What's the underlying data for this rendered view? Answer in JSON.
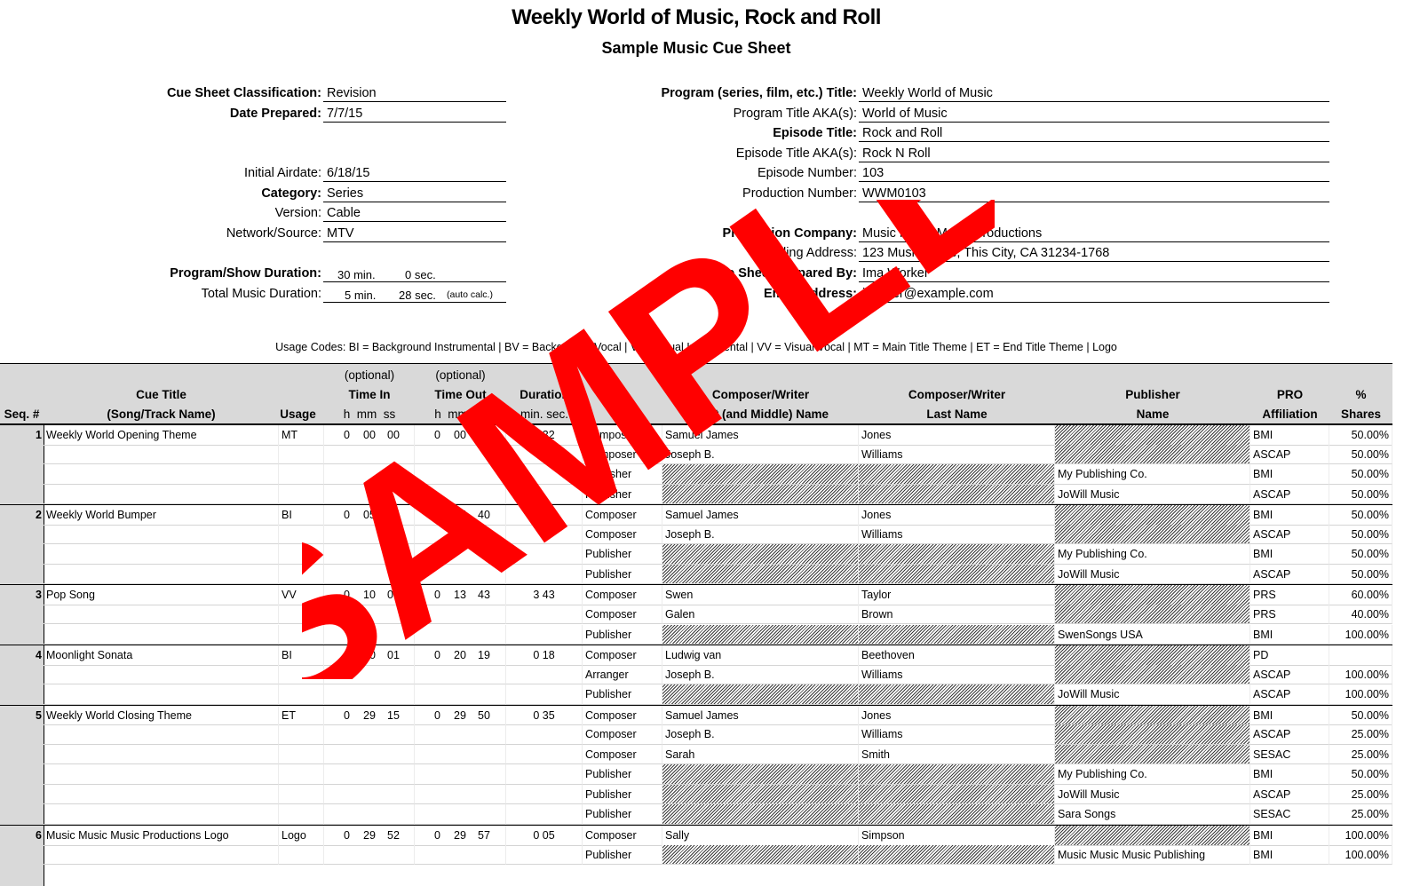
{
  "header": {
    "title": "Weekly World of Music, Rock and Roll",
    "subtitle": "Sample Music Cue Sheet"
  },
  "left_fields": [
    {
      "label": "Cue Sheet Classification:",
      "bold": true,
      "value": "Revision"
    },
    {
      "label": "Date Prepared:",
      "bold": true,
      "value": "7/7/15"
    },
    {
      "label": "Initial Airdate:",
      "bold": false,
      "value": "6/18/15"
    },
    {
      "label": "Category:",
      "bold": true,
      "value": "Series"
    },
    {
      "label": "Version:",
      "bold": false,
      "value": "Cable"
    },
    {
      "label": "Network/Source:",
      "bold": false,
      "value": "MTV"
    }
  ],
  "durations": {
    "program": {
      "label": "Program/Show Duration:",
      "min": "30 min.",
      "sec": "0 sec.",
      "note": ""
    },
    "music": {
      "label": "Total Music Duration:",
      "min": "5 min.",
      "sec": "28 sec.",
      "note": "(auto calc.)"
    }
  },
  "right_fields": [
    {
      "label": "Program (series, film, etc.) Title:",
      "bold": true,
      "value": "Weekly World of Music"
    },
    {
      "label": "Program Title AKA(s):",
      "bold": false,
      "value": "World of Music"
    },
    {
      "label": "Episode Title:",
      "bold": true,
      "value": "Rock and Roll"
    },
    {
      "label": "Episode Title AKA(s):",
      "bold": false,
      "value": "Rock N Roll"
    },
    {
      "label": "Episode Number:",
      "bold": false,
      "value": "103"
    },
    {
      "label": "Production Number:",
      "bold": false,
      "value": "WWM0103"
    },
    {
      "label": "Production Company:",
      "bold": true,
      "value": "Music Music Music Productions"
    },
    {
      "label": "Mailing Address:",
      "bold": false,
      "value": "123 Music Place, This City, CA 31234-1768"
    },
    {
      "label": "Cue Sheet Prepared By:",
      "bold": true,
      "value": "Ima Worker"
    },
    {
      "label": "Email Address:",
      "bold": true,
      "value": "iworker@example.com"
    }
  ],
  "usage_codes": "Usage Codes:  BI = Background Instrumental | BV = Background Vocal | VI = Visual Instrumental | VV = Visual Vocal | MT = Main Title Theme | ET = End Title Theme | Logo",
  "table": {
    "headers": {
      "seq": "Seq. #",
      "cue_title_1": "Cue Title",
      "cue_title_2": "(Song/Track Name)",
      "usage": "Usage",
      "optional": "(optional)",
      "time_in": "Time In",
      "time_out": "Time Out",
      "hms": "h  mm  ss",
      "duration": "Duration",
      "minsec": "min. sec.",
      "first_1": "Composer/Writer",
      "first_2": "First (and Middle) Name",
      "last_1": "Composer/Writer",
      "last_2": "Last Name",
      "pub_1": "Publisher",
      "pub_2": "Name",
      "pro_1": "PRO",
      "pro_2": "Affiliation",
      "share_1": "%",
      "share_2": "Shares"
    },
    "cues": [
      {
        "seq": "1",
        "title": "Weekly World Opening Theme",
        "usage": "MT",
        "time_in": [
          "0",
          "00",
          "00"
        ],
        "time_out": [
          "0",
          "00",
          "32"
        ],
        "duration": "0 32",
        "parties": [
          {
            "role": "Composer",
            "first": "Samuel James",
            "last": "Jones",
            "publisher": "",
            "pro": "BMI",
            "share": "50.00%"
          },
          {
            "role": "Composer",
            "first": "Joseph B.",
            "last": "Williams",
            "publisher": "",
            "pro": "ASCAP",
            "share": "50.00%"
          },
          {
            "role": "Publisher",
            "first": "",
            "last": "",
            "publisher": "My Publishing Co.",
            "pro": "BMI",
            "share": "50.00%"
          },
          {
            "role": "Publisher",
            "first": "",
            "last": "",
            "publisher": "JoWill Music",
            "pro": "ASCAP",
            "share": "50.00%"
          }
        ]
      },
      {
        "seq": "2",
        "title": "Weekly World Bumper",
        "usage": "BI",
        "time_in": [
          "0",
          "05",
          "25"
        ],
        "time_out": [
          "0",
          "05",
          "40"
        ],
        "duration": "0 15",
        "parties": [
          {
            "role": "Composer",
            "first": "Samuel James",
            "last": "Jones",
            "publisher": "",
            "pro": "BMI",
            "share": "50.00%"
          },
          {
            "role": "Composer",
            "first": "Joseph B.",
            "last": "Williams",
            "publisher": "",
            "pro": "ASCAP",
            "share": "50.00%"
          },
          {
            "role": "Publisher",
            "first": "",
            "last": "",
            "publisher": "My Publishing Co.",
            "pro": "BMI",
            "share": "50.00%"
          },
          {
            "role": "Publisher",
            "first": "",
            "last": "",
            "publisher": "JoWill Music",
            "pro": "ASCAP",
            "share": "50.00%"
          }
        ]
      },
      {
        "seq": "3",
        "title": "Pop Song",
        "usage": "VV",
        "time_in": [
          "0",
          "10",
          "00"
        ],
        "time_out": [
          "0",
          "13",
          "43"
        ],
        "duration": "3 43",
        "parties": [
          {
            "role": "Composer",
            "first": "Swen",
            "last": "Taylor",
            "publisher": "",
            "pro": "PRS",
            "share": "60.00%"
          },
          {
            "role": "Composer",
            "first": "Galen",
            "last": "Brown",
            "publisher": "",
            "pro": "PRS",
            "share": "40.00%"
          },
          {
            "role": "Publisher",
            "first": "",
            "last": "",
            "publisher": "SwenSongs USA",
            "pro": "BMI",
            "share": "100.00%"
          }
        ]
      },
      {
        "seq": "4",
        "title": "Moonlight Sonata",
        "usage": "BI",
        "time_in": [
          "0",
          "20",
          "01"
        ],
        "time_out": [
          "0",
          "20",
          "19"
        ],
        "duration": "0 18",
        "parties": [
          {
            "role": "Composer",
            "first": "Ludwig van",
            "last": "Beethoven",
            "publisher": "",
            "pro": "PD",
            "share": ""
          },
          {
            "role": "Arranger",
            "first": "Joseph B.",
            "last": "Williams",
            "publisher": "",
            "pro": "ASCAP",
            "share": "100.00%"
          },
          {
            "role": "Publisher",
            "first": "",
            "last": "",
            "publisher": "JoWill Music",
            "pro": "ASCAP",
            "share": "100.00%"
          }
        ]
      },
      {
        "seq": "5",
        "title": "Weekly World Closing Theme",
        "usage": "ET",
        "time_in": [
          "0",
          "29",
          "15"
        ],
        "time_out": [
          "0",
          "29",
          "50"
        ],
        "duration": "0 35",
        "parties": [
          {
            "role": "Composer",
            "first": "Samuel James",
            "last": "Jones",
            "publisher": "",
            "pro": "BMI",
            "share": "50.00%"
          },
          {
            "role": "Composer",
            "first": "Joseph B.",
            "last": "Williams",
            "publisher": "",
            "pro": "ASCAP",
            "share": "25.00%"
          },
          {
            "role": "Composer",
            "first": "Sarah",
            "last": "Smith",
            "publisher": "",
            "pro": "SESAC",
            "share": "25.00%"
          },
          {
            "role": "Publisher",
            "first": "",
            "last": "",
            "publisher": "My Publishing Co.",
            "pro": "BMI",
            "share": "50.00%"
          },
          {
            "role": "Publisher",
            "first": "",
            "last": "",
            "publisher": "JoWill Music",
            "pro": "ASCAP",
            "share": "25.00%"
          },
          {
            "role": "Publisher",
            "first": "",
            "last": "",
            "publisher": "Sara Songs",
            "pro": "SESAC",
            "share": "25.00%"
          }
        ]
      },
      {
        "seq": "6",
        "title": "Music Music Music Productions Logo",
        "usage": "Logo",
        "time_in": [
          "0",
          "29",
          "52"
        ],
        "time_out": [
          "0",
          "29",
          "57"
        ],
        "duration": "0 05",
        "parties": [
          {
            "role": "Composer",
            "first": "Sally",
            "last": "Simpson",
            "publisher": "",
            "pro": "BMI",
            "share": "100.00%"
          },
          {
            "role": "Publisher",
            "first": "",
            "last": "",
            "publisher": "Music Music Music Publishing",
            "pro": "BMI",
            "share": "100.00%"
          }
        ]
      }
    ]
  },
  "watermark": {
    "text": "SAMPLE",
    "color": "#ff0000"
  }
}
